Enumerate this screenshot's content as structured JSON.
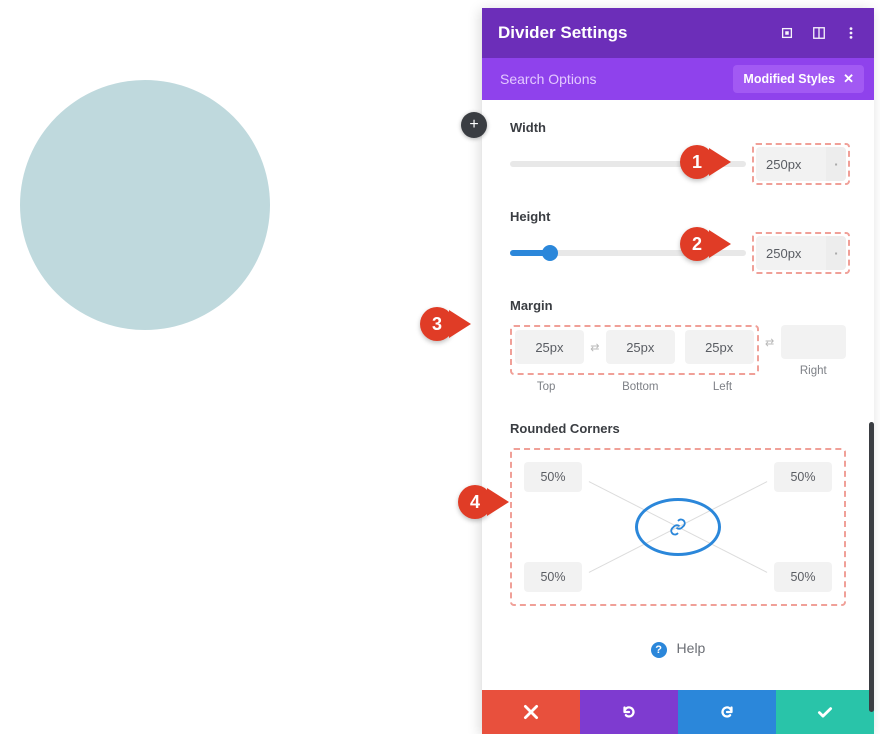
{
  "preview": {
    "shape": "circle"
  },
  "header": {
    "title": "Divider Settings"
  },
  "search": {
    "placeholder": "Search Options",
    "filter_label": "Modified Styles"
  },
  "sections": {
    "width": {
      "label": "Width",
      "value": "250px",
      "slider_percent": 0,
      "show_thumb": false
    },
    "height": {
      "label": "Height",
      "value": "250px",
      "slider_percent": 17,
      "show_thumb": true
    },
    "margin": {
      "label": "Margin",
      "sides": {
        "top": {
          "label": "Top",
          "value": "25px",
          "highlighted": true
        },
        "bottom": {
          "label": "Bottom",
          "value": "25px",
          "highlighted": true
        },
        "left": {
          "label": "Left",
          "value": "25px",
          "highlighted": true
        },
        "right": {
          "label": "Right",
          "value": "",
          "highlighted": false
        }
      }
    },
    "rounded_corners": {
      "label": "Rounded Corners",
      "values": {
        "tl": "50%",
        "tr": "50%",
        "bl": "50%",
        "br": "50%"
      },
      "linked": true
    }
  },
  "help": {
    "label": "Help"
  },
  "footer": {
    "cancel": "cancel",
    "undo": "undo",
    "redo": "redo",
    "save": "save"
  },
  "callouts": {
    "c1": "1",
    "c2": "2",
    "c3": "3",
    "c4": "4"
  }
}
